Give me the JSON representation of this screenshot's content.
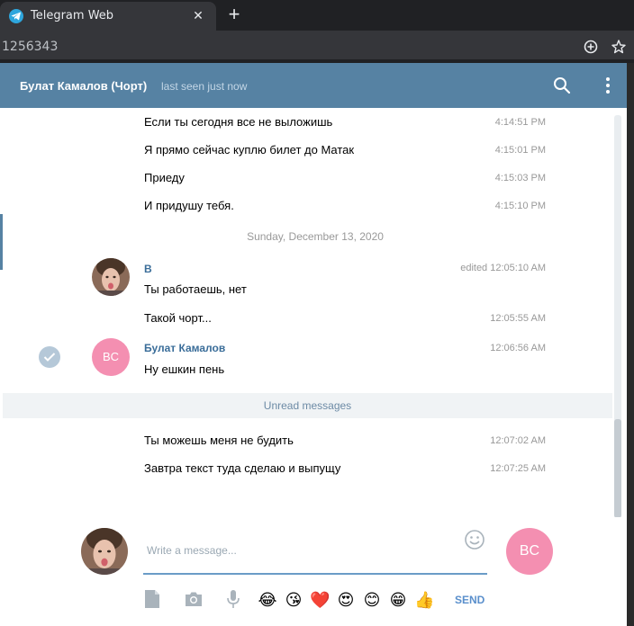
{
  "browser": {
    "tab_title": "Telegram Web",
    "tab_close": "✕",
    "new_tab": "+",
    "url": "1256343"
  },
  "header": {
    "peer_name": "Булат Камалов (Чорт)",
    "status": "last seen just now"
  },
  "messages_top": [
    {
      "text": "Если ты сегодня все не выложишь",
      "time": "4:14:51 PM"
    },
    {
      "text": "Я прямо сейчас куплю билет до Матак",
      "time": "4:15:01 PM"
    },
    {
      "text": "Приеду",
      "time": "4:15:03 PM"
    },
    {
      "text": "И придушу тебя.",
      "time": "4:15:10 PM"
    }
  ],
  "date_separator": "Sunday, December 13, 2020",
  "group_b": {
    "sender": "B",
    "time_first": "edited 12:05:10 AM",
    "messages": [
      {
        "text": "Ты работаешь, нет",
        "time": ""
      },
      {
        "text": "Такой чорт...",
        "time": "12:05:55 AM"
      }
    ]
  },
  "group_bulat": {
    "sender": "Булат Камалов",
    "avatar_initials": "BC",
    "time": "12:06:56 AM",
    "text": "Ну ешкин пень"
  },
  "unread_label": "Unread messages",
  "messages_bottom": [
    {
      "text": "Ты можешь меня не будить",
      "time": "12:07:02 AM"
    },
    {
      "text": "Завтра текст туда сделаю и выпущу",
      "time": "12:07:25 AM"
    }
  ],
  "composer": {
    "placeholder": "Write a message...",
    "peer_initials": "BC",
    "send_label": "SEND",
    "emojis": [
      "😂",
      "😘",
      "❤️",
      "😍",
      "😊",
      "😁",
      "👍"
    ]
  },
  "colors": {
    "header_bg": "#5682a3",
    "avatar_pink": "#f48fb1",
    "link_blue": "#3a6d99"
  }
}
